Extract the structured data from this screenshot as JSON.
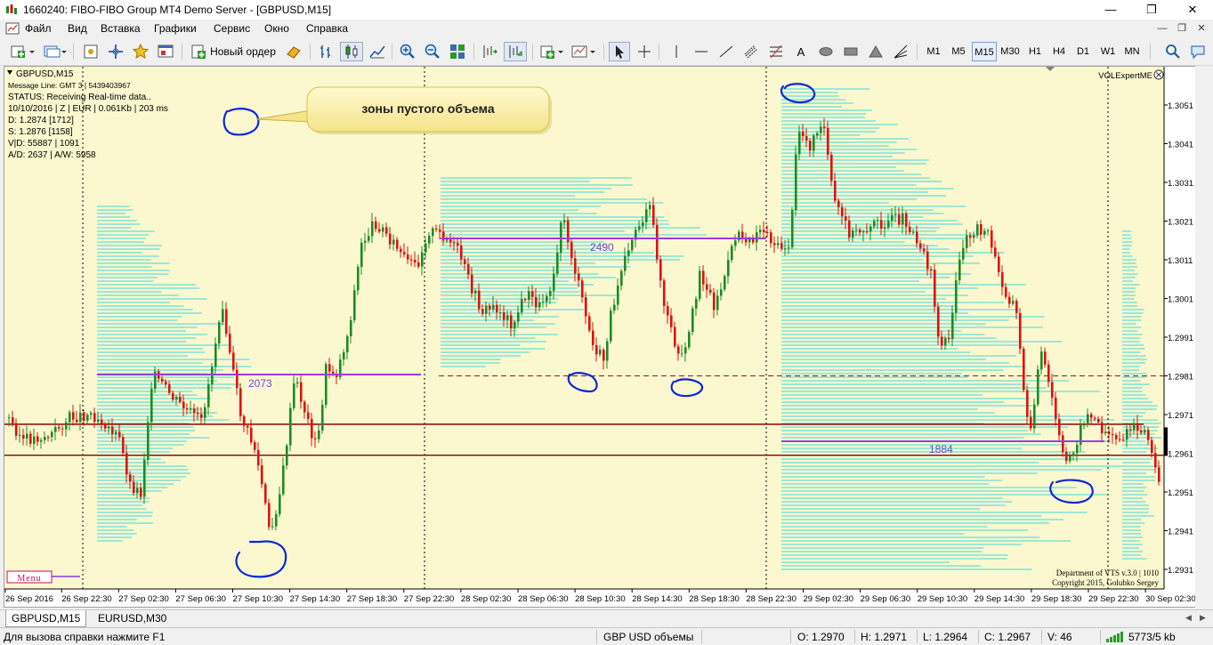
{
  "window": {
    "title": "1660240: FIBO-FIBO Group MT4 Demo Server - [GBPUSD,M15]",
    "controls": [
      "—",
      "❐",
      "✕"
    ],
    "mdi_controls": [
      "—",
      "❐",
      "✕"
    ]
  },
  "menu": [
    "Файл",
    "Вид",
    "Вставка",
    "Графики",
    "Сервис",
    "Окно",
    "Справка"
  ],
  "toolbar": {
    "new_order_label": "Новый ордер",
    "timeframes": [
      "M1",
      "M5",
      "M15",
      "M30",
      "H1",
      "H4",
      "D1",
      "W1",
      "MN"
    ],
    "active_timeframe": "M15",
    "text_tool_label": "A"
  },
  "chart": {
    "symbol_header": "GBPUSD,M15",
    "info_lines": [
      "Message Line: GMT 3 | 5439403967",
      "STATUS:  Receiving Real-time data..",
      "10/10/2016 | Z | EUR | 0.061Kb | 203 ms",
      "D: 1.2874  [1712]",
      "S: 1.2876  [1158]",
      "V|D: 55887 | 1091",
      "A/D: 2637 | A/W: 5958"
    ],
    "callout_text": "зоны пустого объема",
    "indicator_label": "VOLExpertME",
    "poc_labels": [
      "2073",
      "2490",
      "1884"
    ],
    "credits": [
      "Department of VTS  v.3.0 | 1010",
      "Copyright 2015, Golubko Sergey"
    ],
    "menu_button": "Menu",
    "price_ticks": [
      "1.3051",
      "1.3041",
      "1.3031",
      "1.3021",
      "1.3011",
      "1.3001",
      "1.2991",
      "1.2981",
      "1.2971",
      "1.2961",
      "1.2951",
      "1.2941",
      "1.2931"
    ],
    "time_ticks": [
      "26 Sep 2016",
      "26 Sep 22:30",
      "27 Sep 02:30",
      "27 Sep 06:30",
      "27 Sep 10:30",
      "27 Sep 14:30",
      "27 Sep 18:30",
      "27 Sep 22:30",
      "28 Sep 02:30",
      "28 Sep 06:30",
      "28 Sep 10:30",
      "28 Sep 14:30",
      "28 Sep 18:30",
      "28 Sep 22:30",
      "29 Sep 02:30",
      "29 Sep 06:30",
      "29 Sep 10:30",
      "29 Sep 14:30",
      "29 Sep 18:30",
      "29 Sep 22:30",
      "30 Sep 02:30"
    ],
    "horizontal_levels": [
      1.2981,
      1.29685,
      1.29605
    ]
  },
  "tabs": [
    "GBPUSD,M15",
    "EURUSD,M30"
  ],
  "status": {
    "help": "Для вызова справки нажмите F1",
    "profile": "GBP USD объемы",
    "open": "O: 1.2970",
    "high": "H: 1.2971",
    "low": "L: 1.2964",
    "close": "C: 1.2967",
    "volume": "V: 46",
    "traffic": "5773/5 kb"
  },
  "colors": {
    "chart_bg": "#fbf8cf",
    "bull": "#1c8a2a",
    "bear": "#e01010",
    "volume": "#3fd8d8",
    "poc": "#9a3de0",
    "level": "#8b0000",
    "annotation": "#0a28d8",
    "callout_fill": "#fbf2a8"
  }
}
